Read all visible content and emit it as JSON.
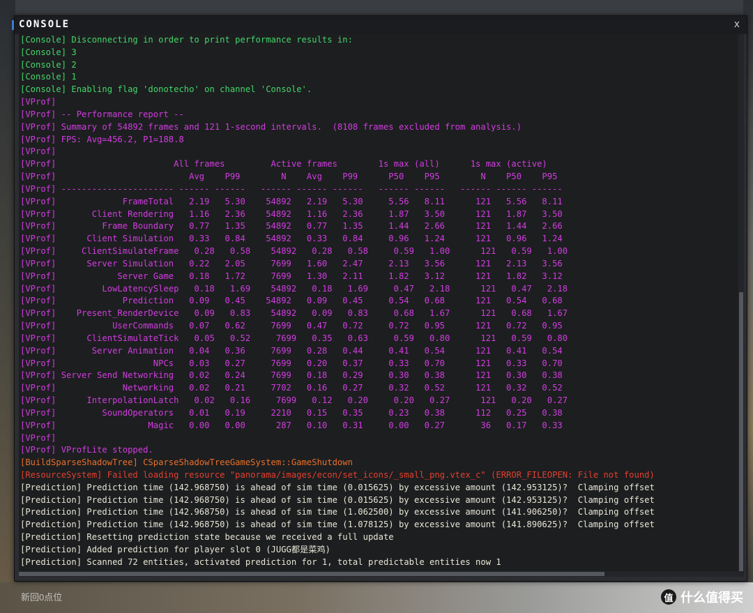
{
  "window": {
    "title": "CONSOLE",
    "close_label": "x"
  },
  "background": {
    "bottom_text": "新回0点位",
    "watermark_badge": "值",
    "watermark_text": "什么值得买"
  },
  "lines": [
    {
      "cls": "console",
      "text": "[Console] Disconnecting in order to print performance results in:"
    },
    {
      "cls": "console",
      "text": "[Console] 3"
    },
    {
      "cls": "console",
      "text": "[Console] 2"
    },
    {
      "cls": "console",
      "text": "[Console] 1"
    },
    {
      "cls": "console",
      "text": "[Console] Enabling flag 'donotecho' on channel 'Console'."
    },
    {
      "cls": "vprof",
      "text": "[VProf]"
    },
    {
      "cls": "vprof",
      "text": "[VProf] -- Performance report --"
    },
    {
      "cls": "vprof",
      "text": "[VProf] Summary of 54892 frames and 121 1-second intervals.  (8108 frames excluded from analysis.)"
    },
    {
      "cls": "vprof",
      "text": "[VProf] FPS: Avg=456.2, P1=188.8"
    },
    {
      "cls": "vprof",
      "text": "[VProf]"
    },
    {
      "cls": "vprof",
      "text": "[VProf]                       All frames         Active frames        1s max (all)      1s max (active)"
    },
    {
      "cls": "vprof",
      "text": "[VProf]                          Avg    P99        N    Avg    P99      P50    P95        N    P50    P95"
    },
    {
      "cls": "vprof",
      "text": "[VProf] ---------------------- ------ ------   ------ ------ ------   ------ ------   ------ ------ ------"
    },
    {
      "cls": "vprof",
      "text": "[VProf]             FrameTotal   2.19   5.30    54892   2.19   5.30     5.56   8.11      121   5.56   8.11"
    },
    {
      "cls": "vprof",
      "text": "[VProf]       Client Rendering   1.16   2.36    54892   1.16   2.36     1.87   3.50      121   1.87   3.50"
    },
    {
      "cls": "vprof",
      "text": "[VProf]         Frame Boundary   0.77   1.35    54892   0.77   1.35     1.44   2.66      121   1.44   2.66"
    },
    {
      "cls": "vprof",
      "text": "[VProf]      Client Simulation   0.33   0.84    54892   0.33   0.84     0.96   1.24      121   0.96   1.24"
    },
    {
      "cls": "vprof",
      "text": "[VProf]     ClientSimulateFrame   0.28   0.58    54892   0.28   0.58     0.59   1.00      121   0.59   1.00"
    },
    {
      "cls": "vprof",
      "text": "[VProf]      Server Simulation   0.22   2.05     7699   1.60   2.47     2.13   3.56      121   2.13   3.56"
    },
    {
      "cls": "vprof",
      "text": "[VProf]            Server Game   0.18   1.72     7699   1.30   2.11     1.82   3.12      121   1.82   3.12"
    },
    {
      "cls": "vprof",
      "text": "[VProf]         LowLatencySleep   0.18   1.69    54892   0.18   1.69     0.47   2.18      121   0.47   2.18"
    },
    {
      "cls": "vprof",
      "text": "[VProf]             Prediction   0.09   0.45    54892   0.09   0.45     0.54   0.68      121   0.54   0.68"
    },
    {
      "cls": "vprof",
      "text": "[VProf]    Present_RenderDevice   0.09   0.83    54892   0.09   0.83     0.68   1.67      121   0.68   1.67"
    },
    {
      "cls": "vprof",
      "text": "[VProf]           UserCommands   0.07   0.62     7699   0.47   0.72     0.72   0.95      121   0.72   0.95"
    },
    {
      "cls": "vprof",
      "text": "[VProf]      ClientSimulateTick   0.05   0.52     7699   0.35   0.63     0.59   0.80      121   0.59   0.80"
    },
    {
      "cls": "vprof",
      "text": "[VProf]       Server Animation   0.04   0.36     7699   0.28   0.44     0.41   0.54      121   0.41   0.54"
    },
    {
      "cls": "vprof",
      "text": "[VProf]                   NPCs   0.03   0.27     7699   0.20   0.37     0.33   0.70      121   0.33   0.70"
    },
    {
      "cls": "vprof",
      "text": "[VProf] Server Send Networking   0.02   0.24     7699   0.18   0.29     0.30   0.38      121   0.30   0.38"
    },
    {
      "cls": "vprof",
      "text": "[VProf]             Networking   0.02   0.21     7702   0.16   0.27     0.32   0.52      121   0.32   0.52"
    },
    {
      "cls": "vprof",
      "text": "[VProf]      InterpolationLatch   0.02   0.16     7699   0.12   0.20     0.20   0.27      121   0.20   0.27"
    },
    {
      "cls": "vprof",
      "text": "[VProf]         SoundOperators   0.01   0.19     2210   0.15   0.35     0.23   0.38      112   0.25   0.38"
    },
    {
      "cls": "vprof",
      "text": "[VProf]                  Magic   0.00   0.00      287   0.10   0.31     0.00   0.27       36   0.17   0.33"
    },
    {
      "cls": "vprof",
      "text": "[VProf]"
    },
    {
      "cls": "vprof",
      "text": "[VProf] VProfLite stopped."
    },
    {
      "cls": "build",
      "text": "[BuildSparseShadowTree] CSparseShadowTreeGameSystem::GameShutdown"
    },
    {
      "cls": "resource",
      "text": "[ResourceSystem] Failed loading resource \"panorama/images/econ/set_icons/_small_png.vtex_c\" (ERROR_FILEOPEN: File not found)"
    },
    {
      "cls": "prediction",
      "text": "[Prediction] Prediction time (142.968750) is ahead of sim time (0.015625) by excessive amount (142.953125)?  Clamping offset"
    },
    {
      "cls": "prediction",
      "text": "[Prediction] Prediction time (142.968750) is ahead of sim time (0.015625) by excessive amount (142.953125)?  Clamping offset"
    },
    {
      "cls": "prediction",
      "text": "[Prediction] Prediction time (142.968750) is ahead of sim time (1.062500) by excessive amount (141.906250)?  Clamping offset"
    },
    {
      "cls": "prediction",
      "text": "[Prediction] Prediction time (142.968750) is ahead of sim time (1.078125) by excessive amount (141.890625)?  Clamping offset"
    },
    {
      "cls": "prediction",
      "text": "[Prediction] Resetting prediction state because we received a full update"
    },
    {
      "cls": "prediction",
      "text": "[Prediction] Added prediction for player slot 0 (JUGG都是菜鸡)"
    },
    {
      "cls": "prediction",
      "text": "[Prediction] Scanned 72 entities, activated prediction for 1, total predictable entities now 1"
    }
  ]
}
